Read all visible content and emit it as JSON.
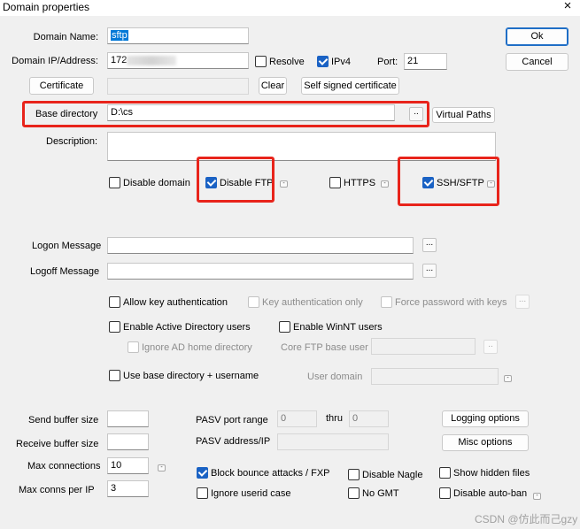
{
  "window": {
    "title": "Domain properties",
    "close_glyph": "×"
  },
  "buttons": {
    "ok": "Ok",
    "cancel": "Cancel",
    "certificate": "Certificate",
    "clear": "Clear",
    "self_signed": "Self signed certificate",
    "browse": "..",
    "virtual_paths": "Virtual Paths",
    "logging_options": "Logging options",
    "misc_options": "Misc options",
    "ellipsis": "..."
  },
  "fields": {
    "domain_name_label": "Domain Name:",
    "domain_name_value": "sftp",
    "domain_ip_label": "Domain IP/Address:",
    "domain_ip_prefix": "172",
    "domain_ip_note": "partially obscured",
    "port_label": "Port:",
    "port_value": "21",
    "base_directory_label": "Base directory",
    "base_directory_value": "D:\\cs",
    "description_label": "Description:",
    "logon_message_label": "Logon Message",
    "logoff_message_label": "Logoff Message",
    "core_ftp_base_user_label": "Core FTP base user",
    "user_domain_label": "User domain",
    "send_buffer_label": "Send buffer size",
    "receive_buffer_label": "Receive buffer size",
    "max_connections_label": "Max connections",
    "max_connections_value": "10",
    "max_conns_per_ip_label": "Max conns per IP",
    "max_conns_per_ip_value": "3",
    "pasv_port_range_label": "PASV port range",
    "pasv_from": "0",
    "pasv_thru_label": "thru",
    "pasv_to": "0",
    "pasv_address_label": "PASV address/IP"
  },
  "checkboxes": {
    "resolve": {
      "label": "Resolve",
      "checked": false
    },
    "ipv4": {
      "label": "IPv4",
      "checked": true
    },
    "disable_domain": {
      "label": "Disable domain",
      "checked": false
    },
    "disable_ftp": {
      "label": "Disable FTP",
      "checked": true
    },
    "https": {
      "label": "HTTPS",
      "checked": false
    },
    "ssh_sftp": {
      "label": "SSH/SFTP",
      "checked": true
    },
    "allow_key_auth": {
      "label": "Allow key authentication",
      "checked": false
    },
    "key_auth_only": {
      "label": "Key authentication only",
      "checked": false,
      "disabled": true
    },
    "force_password_keys": {
      "label": "Force password with keys",
      "checked": false,
      "disabled": true
    },
    "enable_ad_users": {
      "label": "Enable Active Directory users",
      "checked": false
    },
    "enable_winnt_users": {
      "label": "Enable WinNT users",
      "checked": false
    },
    "ignore_ad_home": {
      "label": "Ignore AD home directory",
      "checked": false,
      "disabled": true
    },
    "use_base_dir_username": {
      "label": "Use base directory + username",
      "checked": false
    },
    "block_bounce": {
      "label": "Block bounce attacks / FXP",
      "checked": true
    },
    "disable_nagle": {
      "label": "Disable Nagle",
      "checked": false
    },
    "show_hidden": {
      "label": "Show hidden files",
      "checked": false
    },
    "ignore_userid_case": {
      "label": "Ignore userid case",
      "checked": false
    },
    "no_gmt": {
      "label": "No GMT",
      "checked": false
    },
    "disable_auto_ban": {
      "label": "Disable auto-ban",
      "checked": false
    }
  },
  "watermark": "CSDN @仿此而己gzy",
  "colors": {
    "highlight_box": "#e8241b",
    "accent": "#1a62c4"
  }
}
